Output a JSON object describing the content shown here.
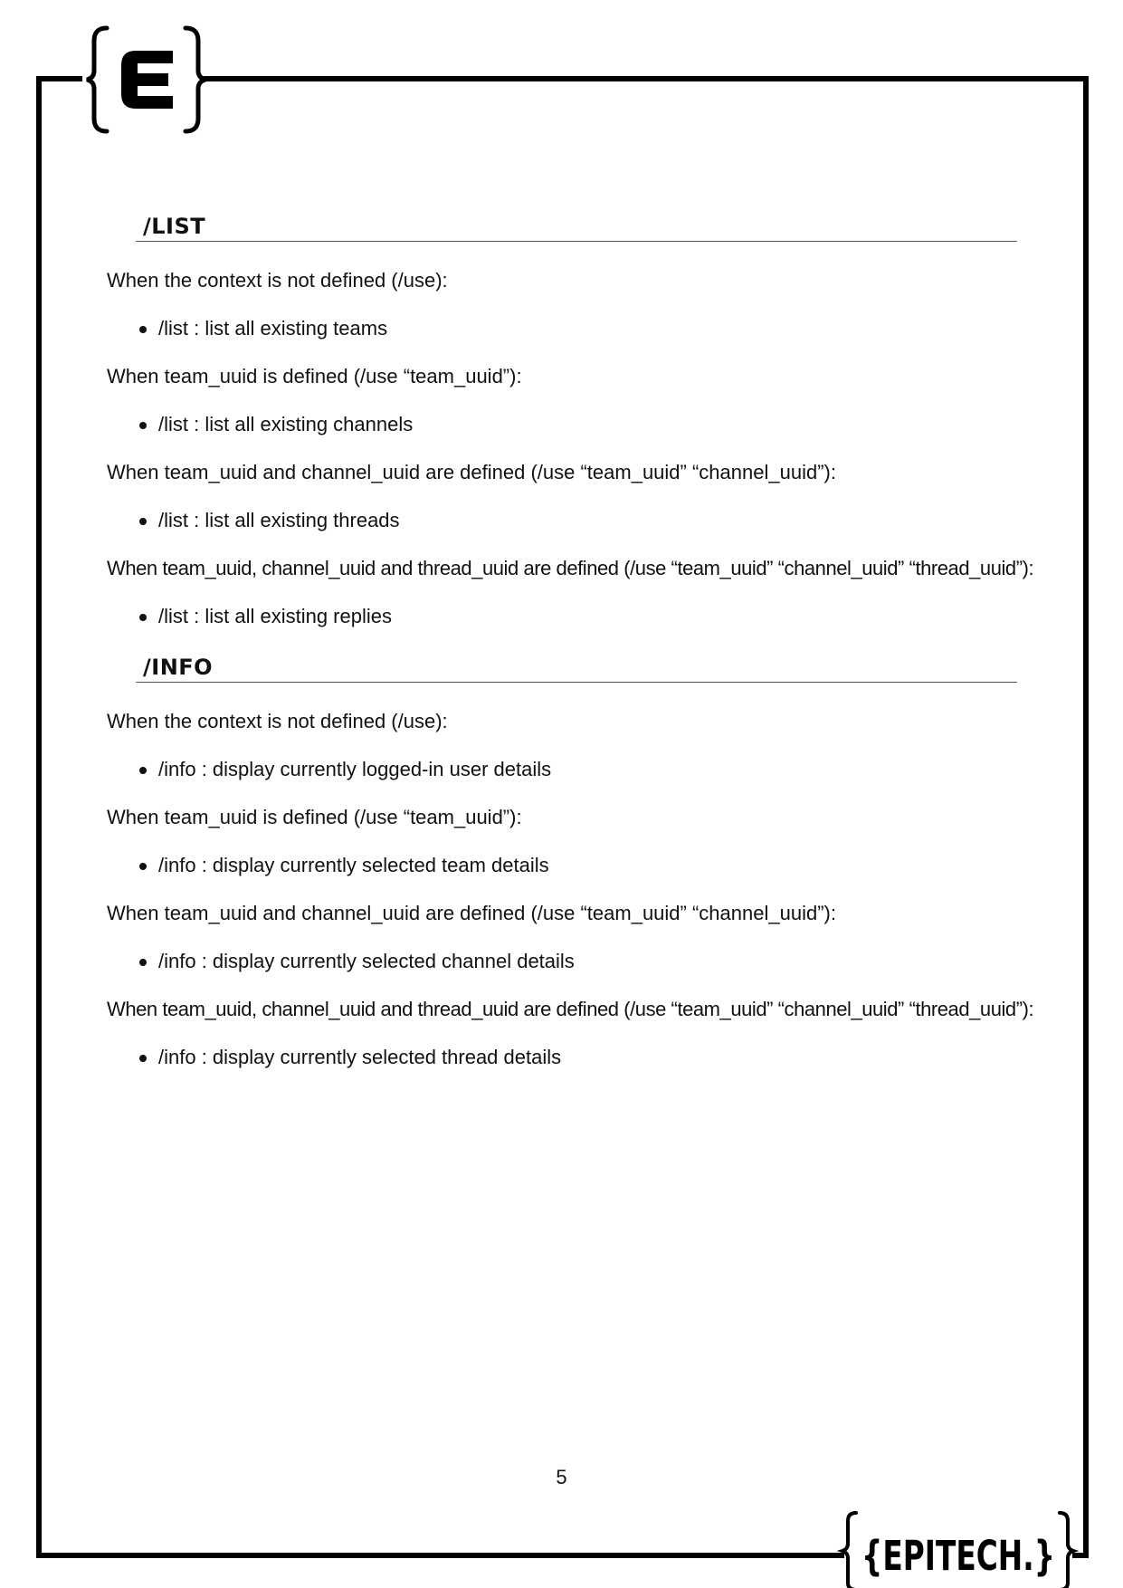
{
  "header_logo": {
    "text": "{E}",
    "icon": "epitech-e-logo"
  },
  "footer_logo": {
    "text": "{EPITECH.}",
    "icon": "epitech-wordmark-logo"
  },
  "sections": [
    {
      "heading": "/LIST",
      "items": [
        {
          "type": "para",
          "text": "When the context is not defined (/use):"
        },
        {
          "type": "bullet",
          "text": "/list : list all existing teams"
        },
        {
          "type": "para",
          "text": "When team_uuid is defined (/use “team_uuid”):"
        },
        {
          "type": "bullet",
          "text": "/list : list all existing channels"
        },
        {
          "type": "para",
          "text": "When team_uuid and channel_uuid are defined (/use “team_uuid” “channel_uuid”):"
        },
        {
          "type": "bullet",
          "text": "/list : list all existing threads"
        },
        {
          "type": "para",
          "text": "When team_uuid, channel_uuid and thread_uuid are defined (/use “team_uuid” “channel_uuid” “thread_uuid”):"
        },
        {
          "type": "bullet",
          "text": "/list : list all existing replies"
        }
      ]
    },
    {
      "heading": "/INFO",
      "items": [
        {
          "type": "para",
          "text": "When the context is not defined (/use):"
        },
        {
          "type": "bullet",
          "text": "/info : display currently logged-in user details"
        },
        {
          "type": "para",
          "text": "When team_uuid is defined (/use “team_uuid”):"
        },
        {
          "type": "bullet",
          "text": "/info : display currently selected team details"
        },
        {
          "type": "para",
          "text": "When team_uuid and channel_uuid are defined (/use “team_uuid” “channel_uuid”):"
        },
        {
          "type": "bullet",
          "text": "/info : display currently selected channel details"
        },
        {
          "type": "para",
          "text": "When team_uuid, channel_uuid and thread_uuid are defined (/use “team_uuid” “channel_uuid” “thread_uuid”):"
        },
        {
          "type": "bullet",
          "text": "/info : display currently selected thread details"
        }
      ]
    }
  ],
  "page_number": "5"
}
